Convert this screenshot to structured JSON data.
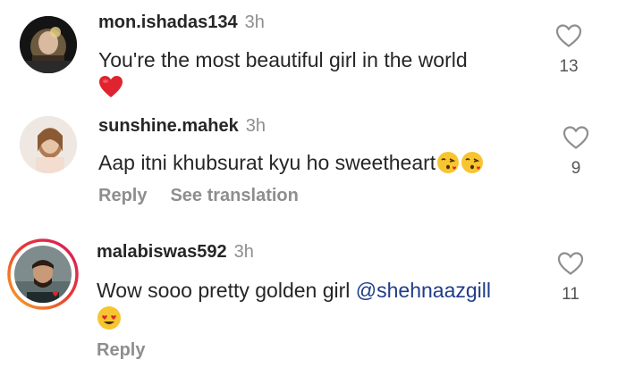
{
  "comments": [
    {
      "username": "mon.ishadas134",
      "time": "3h",
      "text": "You're the most beautiful girl in the world",
      "emoji_line": "red-heart",
      "likes": "13",
      "actions": []
    },
    {
      "username": "sunshine.mahek",
      "time": "3h",
      "text": "Aap itni khubsurat kyu ho sweetheart",
      "inline_emojis": [
        "face-blowing-kiss",
        "face-blowing-kiss"
      ],
      "likes": "9",
      "actions": {
        "reply": "Reply",
        "see_translation": "See translation"
      }
    },
    {
      "username": "malabiswas592",
      "time": "3h",
      "text": "Wow sooo pretty golden girl ",
      "mention": "@shehnaazgill",
      "emoji_line": "heart-eyes-face",
      "likes": "11",
      "actions": {
        "reply": "Reply"
      }
    }
  ],
  "colors": {
    "username": "#262626",
    "meta": "#8e8e8e",
    "mention": "#1f3c88",
    "story_ring_start": "#f9a825",
    "story_ring_end": "#d81b60"
  }
}
